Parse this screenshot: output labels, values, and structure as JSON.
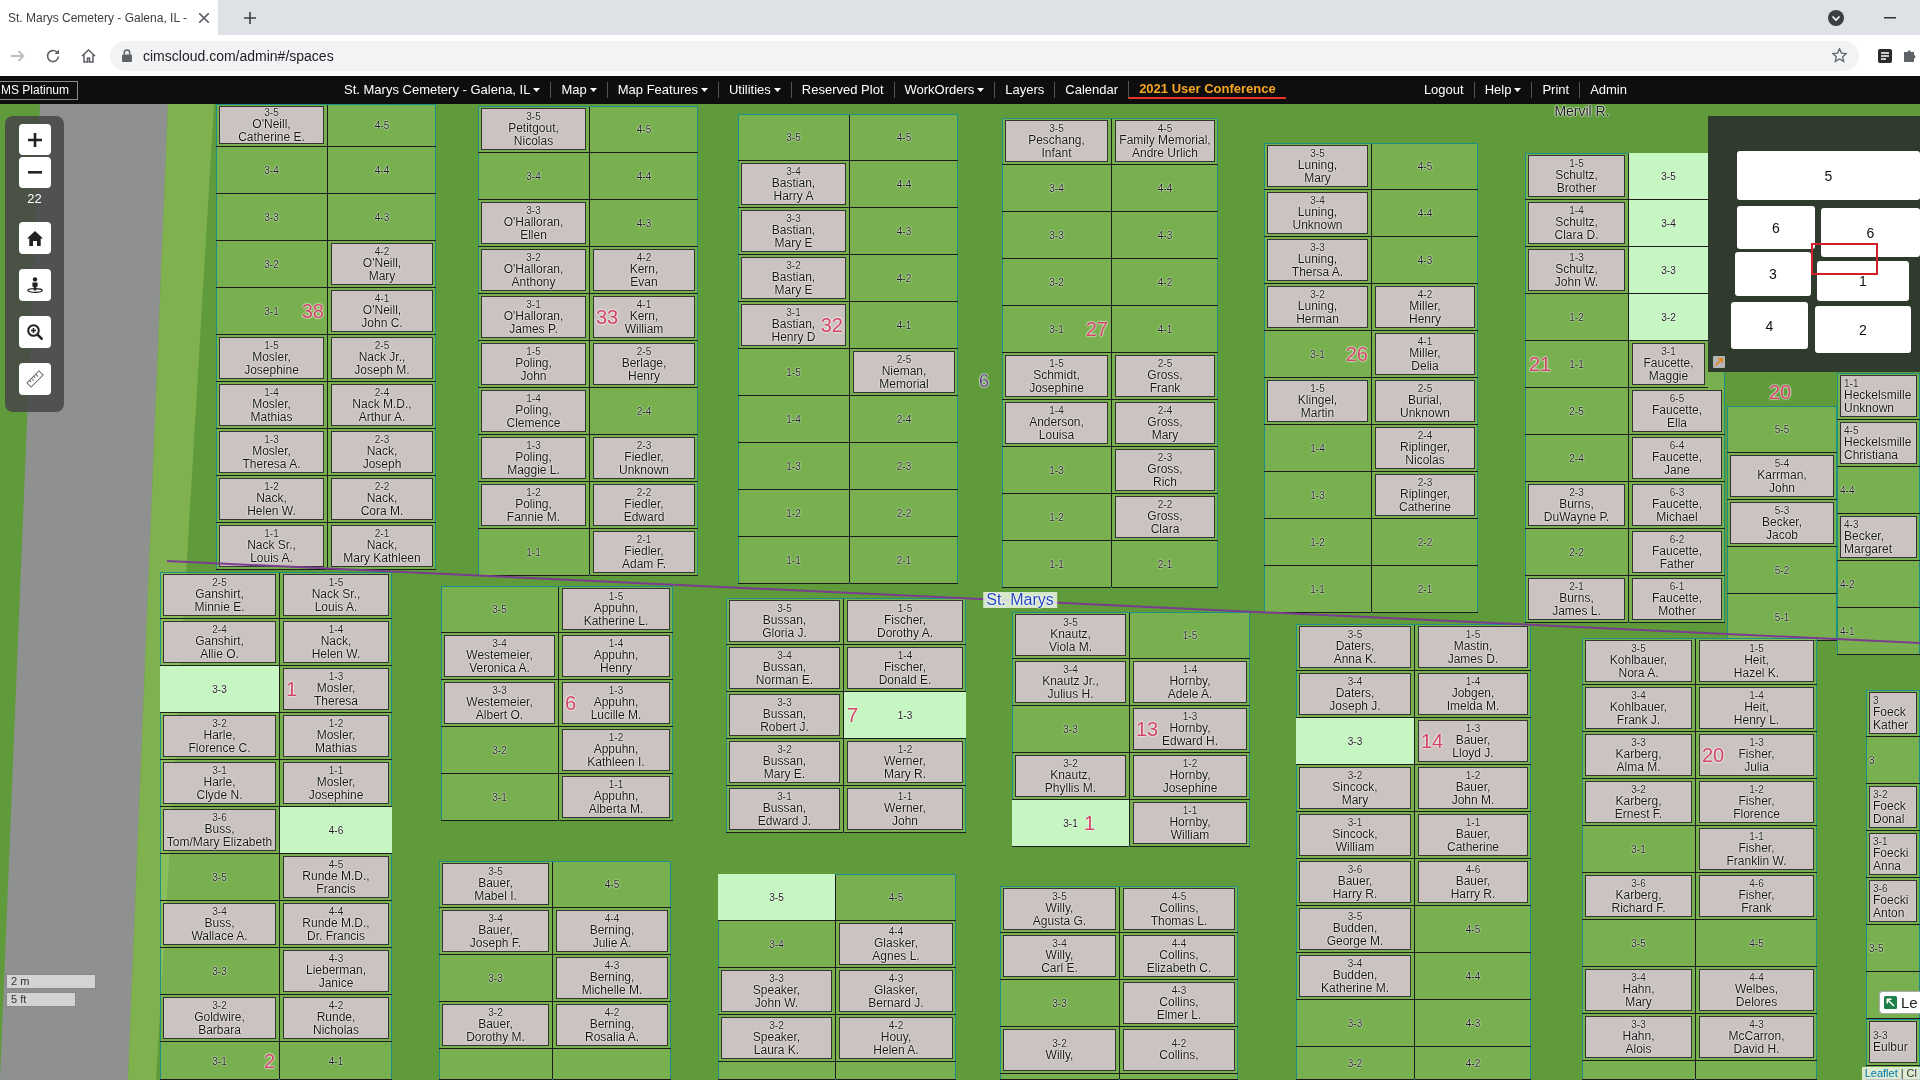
{
  "browser": {
    "tab_title": "St. Marys Cemetery - Galena, IL -",
    "url": "cimscloud.com/admin#/spaces"
  },
  "navbar": {
    "brand": "MS Platinum",
    "items": [
      {
        "label": "St. Marys Cemetery - Galena, IL",
        "menu": true,
        "highlighted": false
      },
      {
        "label": "Map",
        "menu": true,
        "highlighted": false
      },
      {
        "label": "Map Features",
        "menu": true,
        "highlighted": false
      },
      {
        "label": "Utilities",
        "menu": true,
        "highlighted": false
      },
      {
        "label": "Reserved Plot",
        "menu": false,
        "highlighted": false
      },
      {
        "label": "WorkOrders",
        "menu": true,
        "highlighted": false
      },
      {
        "label": "Layers",
        "menu": false,
        "highlighted": false
      },
      {
        "label": "Calendar",
        "menu": false,
        "highlighted": false
      },
      {
        "label": "2021 User Conference",
        "menu": false,
        "highlighted": true
      }
    ],
    "right_items": [
      {
        "label": "Logout",
        "menu": false,
        "highlighted": false
      },
      {
        "label": "Help",
        "menu": true,
        "highlighted": false
      },
      {
        "label": "Print",
        "menu": false,
        "highlighted": false
      },
      {
        "label": "Admin",
        "menu": false,
        "highlighted": false
      }
    ]
  },
  "map": {
    "zoom_level": "22",
    "blocks": [
      {
        "columns": [
          [
            {
              "plot": "3-5",
              "name": "O'Neill,\nCatherine E.",
              "available": false
            },
            {
              "plot": "3-4",
              "available": false
            },
            {
              "plot": "3-3",
              "available": false
            },
            {
              "plot": "3-2",
              "available": false
            },
            {
              "plot": "3-1",
              "available": false
            },
            {
              "plot": "1-5",
              "name": "Mosler,\nJosephine",
              "available": false
            },
            {
              "plot": "1-4",
              "name": "Mosler,\nMathias",
              "available": false
            },
            {
              "plot": "1-3",
              "name": "Mosler,\nTheresa A.",
              "available": false
            },
            {
              "plot": "1-2",
              "name": "Nack,\nHelen W.",
              "available": false
            },
            {
              "plot": "1-1",
              "name": "Nack Sr.,\nLouis A.",
              "available": false
            }
          ],
          [
            {
              "plot": "4-5",
              "available": false
            },
            {
              "plot": "4-4",
              "available": false
            },
            {
              "plot": "4-3",
              "available": false
            },
            {
              "plot": "4-2",
              "name": "O'Neill,\nMary",
              "available": false
            },
            {
              "plot": "4-1",
              "name": "O'Neill,\nJohn C.",
              "available": false
            },
            {
              "plot": "2-5",
              "name": "Nack Jr.,\nJoseph M.",
              "available": false
            },
            {
              "plot": "2-4",
              "name": "Nack M.D.,\nArthur A.",
              "available": false
            },
            {
              "plot": "2-3",
              "name": "Nack,\nJoseph",
              "available": false
            },
            {
              "plot": "2-2",
              "name": "Nack,\nCora M.",
              "available": false
            },
            {
              "plot": "2-1",
              "name": "Nack,\nMary Kathleen",
              "available": false
            }
          ]
        ]
      },
      {
        "columns": [
          [
            {
              "plot": "3-5",
              "name": "Petitgout,\nNicolas",
              "available": false
            },
            {
              "plot": "3-4",
              "available": false
            },
            {
              "plot": "3-3",
              "name": "O'Halloran,\nEllen",
              "available": false
            },
            {
              "plot": "3-2",
              "name": "O'Halloran,\nAnthony",
              "available": false
            },
            {
              "plot": "3-1",
              "name": "O'Halloran,\nJames P.",
              "available": false
            },
            {
              "plot": "1-5",
              "name": "Poling,\nJohn",
              "available": false
            },
            {
              "plot": "1-4",
              "name": "Poling,\nClemence",
              "available": false
            },
            {
              "plot": "1-3",
              "name": "Poling,\nMaggie L.",
              "available": false
            },
            {
              "plot": "1-2",
              "name": "Poling,\nFannie M.",
              "available": false
            },
            {
              "plot": "1-1",
              "available": false
            }
          ],
          [
            {
              "plot": "4-5",
              "available": false
            },
            {
              "plot": "4-4",
              "available": false
            },
            {
              "plot": "4-3",
              "available": false
            },
            {
              "plot": "4-2",
              "name": "Kern,\nEvan",
              "available": false
            },
            {
              "plot": "4-1",
              "name": "Kern,\nWilliam",
              "available": false
            },
            {
              "plot": "2-5",
              "name": "Berlage,\nHenry",
              "available": false
            },
            {
              "plot": "2-4",
              "available": false
            },
            {
              "plot": "2-3",
              "name": "Fiedler,\nUnknown",
              "available": false
            },
            {
              "plot": "2-2",
              "name": "Fiedler,\nEdward",
              "available": false
            },
            {
              "plot": "2-1",
              "name": "Fiedler,\nAdam F.",
              "available": false
            }
          ]
        ]
      },
      {
        "columns": [
          [
            {
              "plot": "3-5",
              "available": false
            },
            {
              "plot": "3-4",
              "name": "Bastian,\nHarry A",
              "available": false
            },
            {
              "plot": "3-3",
              "name": "Bastian,\nMary E",
              "available": false
            },
            {
              "plot": "3-2",
              "name": "Bastian,\nMary E",
              "available": false
            },
            {
              "plot": "3-1",
              "name": "Bastian,\nHenry D",
              "available": false
            },
            {
              "plot": "1-5",
              "available": false
            },
            {
              "plot": "1-4",
              "available": false
            },
            {
              "plot": "1-3",
              "available": false
            },
            {
              "plot": "1-2",
              "available": false
            },
            {
              "plot": "1-1",
              "available": false
            }
          ],
          [
            {
              "plot": "4-5",
              "available": false
            },
            {
              "plot": "4-4",
              "available": false
            },
            {
              "plot": "4-3",
              "available": false
            },
            {
              "plot": "4-2",
              "available": false
            },
            {
              "plot": "4-1",
              "available": false
            },
            {
              "plot": "2-5",
              "name": "Nieman,\nMemorial",
              "available": false
            },
            {
              "plot": "2-4",
              "available": false
            },
            {
              "plot": "2-3",
              "available": false
            },
            {
              "plot": "2-2",
              "available": false
            },
            {
              "plot": "2-1",
              "available": false
            }
          ]
        ]
      },
      {
        "columns": [
          [
            {
              "plot": "3-5",
              "name": "Peschang,\nInfant",
              "available": false
            },
            {
              "plot": "3-4",
              "available": false
            },
            {
              "plot": "3-3",
              "available": false
            },
            {
              "plot": "3-2",
              "available": false
            },
            {
              "plot": "3-1",
              "available": false
            },
            {
              "plot": "1-5",
              "name": "Schmidt,\nJosephine",
              "available": false
            },
            {
              "plot": "1-4",
              "name": "Anderson,\nLouisa",
              "available": false
            },
            {
              "plot": "1-3",
              "available": false
            },
            {
              "plot": "1-2",
              "available": false
            },
            {
              "plot": "1-1",
              "available": false
            }
          ],
          [
            {
              "plot": "4-5",
              "name": "Family Memorial,\nAndre Urlich",
              "available": false
            },
            {
              "plot": "4-4",
              "available": false
            },
            {
              "plot": "4-3",
              "available": false
            },
            {
              "plot": "4-2",
              "available": false
            },
            {
              "plot": "4-1",
              "available": false
            },
            {
              "plot": "2-5",
              "name": "Gross,\nFrank",
              "available": false
            },
            {
              "plot": "2-4",
              "name": "Gross,\nMary",
              "available": false
            },
            {
              "plot": "2-3",
              "name": "Gross,\nRich",
              "available": false
            },
            {
              "plot": "2-2",
              "name": "Gross,\nClara",
              "available": false
            },
            {
              "plot": "2-1",
              "available": false
            }
          ]
        ]
      },
      {
        "columns": [
          [
            {
              "plot": "3-5",
              "name": "Luning,\nMary",
              "available": false
            },
            {
              "plot": "3-4",
              "name": "Luning,\nUnknown",
              "available": false
            },
            {
              "plot": "3-3",
              "name": "Luning,\nThersa A.",
              "available": false
            },
            {
              "plot": "3-2",
              "name": "Luning,\nHerman",
              "available": false
            },
            {
              "plot": "3-1",
              "available": false
            },
            {
              "plot": "1-5",
              "name": "Klingel,\nMartin",
              "available": false
            },
            {
              "plot": "1-4",
              "available": false
            },
            {
              "plot": "1-3",
              "available": false
            },
            {
              "plot": "1-2",
              "available": false
            },
            {
              "plot": "1-1",
              "available": false
            }
          ],
          [
            {
              "plot": "4-5",
              "available": false
            },
            {
              "plot": "4-4",
              "available": false
            },
            {
              "plot": "4-3",
              "available": false
            },
            {
              "plot": "4-2",
              "name": "Miller,\nHenry",
              "available": false
            },
            {
              "plot": "4-1",
              "name": "Miller,\nDelia",
              "available": false
            },
            {
              "plot": "2-5",
              "name": "Burial,\nUnknown",
              "available": false
            },
            {
              "plot": "2-4",
              "name": "Riplinger,\nNicolas",
              "available": false
            },
            {
              "plot": "2-3",
              "name": "Riplinger,\nCatherine",
              "available": false
            },
            {
              "plot": "2-2",
              "available": false
            },
            {
              "plot": "2-1",
              "available": false
            }
          ]
        ]
      },
      {
        "columns": [
          [
            {
              "plot": "1-5",
              "name": "Schultz,\nBrother",
              "available": false
            },
            {
              "plot": "1-4",
              "name": "Schultz,\nClara D.",
              "available": false
            },
            {
              "plot": "1-3",
              "name": "Schultz,\nJohn W.",
              "available": false
            },
            {
              "plot": "1-2",
              "available": false
            },
            {
              "plot": "1-1",
              "available": false
            },
            {
              "plot": "2-5",
              "available": false
            },
            {
              "plot": "2-4",
              "available": false
            },
            {
              "plot": "2-3",
              "name": "Burns,\nDuWayne P.",
              "available": false
            },
            {
              "plot": "2-2",
              "available": false
            },
            {
              "plot": "2-1",
              "name": "Burns,\nJames L.",
              "available": false
            }
          ],
          [
            {
              "plot": "3-5",
              "available": true
            },
            {
              "plot": "3-4",
              "available": true
            },
            {
              "plot": "3-3",
              "available": true
            },
            {
              "plot": "3-2",
              "available": true
            },
            {
              "plot": "3-1",
              "name": "Faucette,\nMaggie",
              "available": false
            },
            {
              "plot": "6-5",
              "name": "Faucette,\nElla",
              "available": false
            },
            {
              "plot": "6-4",
              "name": "Faucette,\nJane",
              "available": false
            },
            {
              "plot": "6-3",
              "name": "Faucette,\nMichael",
              "available": false
            },
            {
              "plot": "6-2",
              "name": "Faucette,\nFather",
              "available": false
            },
            {
              "plot": "6-1",
              "name": "Faucette,\nMother",
              "available": false
            }
          ]
        ]
      },
      {
        "columns": [
          [
            {
              "plot": "5-5",
              "available": false
            },
            {
              "plot": "5-4",
              "name": "Karrman,\nJohn",
              "available": false
            },
            {
              "plot": "5-3",
              "name": "Becker,\nJacob",
              "available": false
            },
            {
              "plot": "5-2",
              "available": false
            },
            {
              "plot": "5-1",
              "available": false
            }
          ]
        ]
      },
      {
        "columns": [
          [
            {
              "plot": "1-1",
              "name": "Heckelsmille\nUnknown",
              "available": false
            },
            {
              "plot": "4-5",
              "name": "Heckelsmille\nChristiana",
              "available": false
            },
            {
              "plot": "4-4",
              "available": false
            },
            {
              "plot": "4-3",
              "name": "Becker,\nMargaret",
              "available": false
            },
            {
              "plot": "4-2",
              "available": false
            },
            {
              "plot": "4-1",
              "available": false
            }
          ]
        ]
      },
      {
        "columns": [
          [
            {
              "plot": "2-5",
              "name": "Ganshirt,\nMinnie E.",
              "available": false
            },
            {
              "plot": "2-4",
              "name": "Ganshirt,\nAllie O.",
              "available": false
            },
            {
              "plot": "3-3",
              "available": true
            },
            {
              "plot": "3-2",
              "name": "Harle,\nFlorence C.",
              "available": false
            },
            {
              "plot": "3-1",
              "name": "Harle,\nClyde N.",
              "available": false
            },
            {
              "plot": "3-6",
              "name": "Buss,\nTom/Mary Elizabeth",
              "available": false
            },
            {
              "plot": "3-5",
              "available": false
            },
            {
              "plot": "3-4",
              "name": "Buss,\nWallace A.",
              "available": false
            },
            {
              "plot": "3-3",
              "available": false
            },
            {
              "plot": "3-2",
              "name": "Goldwire,\nBarbara",
              "available": false
            },
            {
              "plot": "3-1",
              "available": false
            }
          ],
          [
            {
              "plot": "1-5",
              "name": "Nack Sr.,\nLouis A.",
              "available": false
            },
            {
              "plot": "1-4",
              "name": "Nack,\nHelen W.",
              "available": false
            },
            {
              "plot": "1-3",
              "name": "Mosler,\nTheresa",
              "available": false
            },
            {
              "plot": "1-2",
              "name": "Mosler,\nMathias",
              "available": false
            },
            {
              "plot": "1-1",
              "name": "Mosler,\nJosephine",
              "available": false
            },
            {
              "plot": "4-6",
              "available": true
            },
            {
              "plot": "4-5",
              "name": "Runde M.D.,\nFrancis",
              "available": false
            },
            {
              "plot": "4-4",
              "name": "Runde M.D.,\nDr. Francis",
              "available": false
            },
            {
              "plot": "4-3",
              "name": "Lieberman,\nJanice",
              "available": false
            },
            {
              "plot": "4-2",
              "name": "Runde,\nNicholas",
              "available": false
            },
            {
              "plot": "4-1",
              "available": false
            }
          ]
        ]
      },
      {
        "columns": [
          [
            {
              "plot": "3-5",
              "available": false
            },
            {
              "plot": "3-4",
              "name": "Westemeier,\nVeronica A.",
              "available": false
            },
            {
              "plot": "3-3",
              "name": "Westemeier,\nAlbert O.",
              "available": false
            },
            {
              "plot": "3-2",
              "available": false
            },
            {
              "plot": "3-1",
              "available": false
            }
          ],
          [
            {
              "plot": "1-5",
              "name": "Appuhn,\nKatherine L.",
              "available": false
            },
            {
              "plot": "1-4",
              "name": "Appuhn,\nHenry",
              "available": false
            },
            {
              "plot": "1-3",
              "name": "Appuhn,\nLucille M.",
              "available": false
            },
            {
              "plot": "1-2",
              "name": "Appuhn,\nKathleen I.",
              "available": false
            },
            {
              "plot": "1-1",
              "name": "Appuhn,\nAlberta M.",
              "available": false
            }
          ]
        ]
      },
      {
        "columns": [
          [
            {
              "plot": "3-5",
              "name": "Bussan,\nGloria J.",
              "available": false
            },
            {
              "plot": "3-4",
              "name": "Bussan,\nNorman E.",
              "available": false
            },
            {
              "plot": "3-3",
              "name": "Bussan,\nRobert J.",
              "available": false
            },
            {
              "plot": "3-2",
              "name": "Bussan,\nMary E.",
              "available": false
            },
            {
              "plot": "3-1",
              "name": "Bussan,\nEdward J.",
              "available": false
            }
          ],
          [
            {
              "plot": "1-5",
              "name": "Fischer,\nDorothy A.",
              "available": false
            },
            {
              "plot": "1-4",
              "name": "Fischer,\nDonald E.",
              "available": false
            },
            {
              "plot": "1-3",
              "available": true
            },
            {
              "plot": "1-2",
              "name": "Werner,\nMary R.",
              "available": false
            },
            {
              "plot": "1-1",
              "name": "Werner,\nJohn",
              "available": false
            }
          ]
        ]
      },
      {
        "columns": [
          [
            {
              "plot": "3-5",
              "name": "Knautz,\nViola M.",
              "available": false
            },
            {
              "plot": "3-4",
              "name": "Knautz Jr.,\nJulius H.",
              "available": false
            },
            {
              "plot": "3-3",
              "available": false
            },
            {
              "plot": "3-2",
              "name": "Knautz,\nPhyllis M.",
              "available": false
            },
            {
              "plot": "3-1",
              "available": true
            }
          ],
          [
            {
              "plot": "1-5",
              "available": false
            },
            {
              "plot": "1-4",
              "name": "Hornby,\nAdele A.",
              "available": false
            },
            {
              "plot": "1-3",
              "name": "Hornby,\nEdward H.",
              "available": false
            },
            {
              "plot": "1-2",
              "name": "Hornby,\nJosephine",
              "available": false
            },
            {
              "plot": "1-1",
              "name": "Hornby,\nWilliam",
              "available": false
            }
          ]
        ]
      },
      {
        "columns": [
          [
            {
              "plot": "3-5",
              "name": "Daters,\nAnna K.",
              "available": false
            },
            {
              "plot": "3-4",
              "name": "Daters,\nJoseph J.",
              "available": false
            },
            {
              "plot": "3-3",
              "available": true
            },
            {
              "plot": "3-2",
              "name": "Sincock,\nMary",
              "available": false
            },
            {
              "plot": "3-1",
              "name": "Sincock,\nWilliam",
              "available": false
            },
            {
              "plot": "3-6",
              "name": "Bauer,\nHarry R.",
              "available": false
            },
            {
              "plot": "3-5",
              "name": "Budden,\nGeorge M.",
              "available": false
            },
            {
              "plot": "3-4",
              "name": "Budden,\nKatherine M.",
              "available": false
            },
            {
              "plot": "3-3",
              "available": false
            },
            {
              "plot": "3-2",
              "available": false
            }
          ],
          [
            {
              "plot": "1-5",
              "name": "Mastin,\nJames D.",
              "available": false
            },
            {
              "plot": "1-4",
              "name": "Jobgen,\nImelda M.",
              "available": false
            },
            {
              "plot": "1-3",
              "name": "Bauer,\nLloyd J.",
              "available": false
            },
            {
              "plot": "1-2",
              "name": "Bauer,\nJohn M.",
              "available": false
            },
            {
              "plot": "1-1",
              "name": "Bauer,\nCatherine",
              "available": false
            },
            {
              "plot": "4-6",
              "name": "Bauer,\nHarry R.",
              "available": false
            },
            {
              "plot": "4-5",
              "available": false
            },
            {
              "plot": "4-4",
              "available": false
            },
            {
              "plot": "4-3",
              "available": false
            },
            {
              "plot": "4-2",
              "available": false
            }
          ]
        ]
      },
      {
        "columns": [
          [
            {
              "plot": "3-5",
              "name": "Kohlbauer,\nNora A.",
              "available": false
            },
            {
              "plot": "3-4",
              "name": "Kohlbauer,\nFrank J.",
              "available": false
            },
            {
              "plot": "3-3",
              "name": "Karberg,\nAlma M.",
              "available": false
            },
            {
              "plot": "3-2",
              "name": "Karberg,\nErnest F.",
              "available": false
            },
            {
              "plot": "3-1",
              "available": false
            },
            {
              "plot": "3-6",
              "name": "Karberg,\nRichard F.",
              "available": false
            },
            {
              "plot": "3-5",
              "available": false
            },
            {
              "plot": "3-4",
              "name": "Hahn,\nMary",
              "available": false
            },
            {
              "plot": "3-3",
              "name": "Hahn,\nAlois",
              "available": false
            }
          ],
          [
            {
              "plot": "1-5",
              "name": "Heit,\nHazel K.",
              "available": false
            },
            {
              "plot": "1-4",
              "name": "Heit,\nHenry L.",
              "available": false
            },
            {
              "plot": "1-3",
              "name": "Fisher,\nJulia",
              "available": false
            },
            {
              "plot": "1-2",
              "name": "Fisher,\nFlorence",
              "available": false
            },
            {
              "plot": "1-1",
              "name": "Fisher,\nFranklin W.",
              "available": false
            },
            {
              "plot": "4-6",
              "name": "Fisher,\nFrank",
              "available": false
            },
            {
              "plot": "4-5",
              "available": false
            },
            {
              "plot": "4-4",
              "name": "Welbes,\nDelores",
              "available": false
            },
            {
              "plot": "4-3",
              "name": "McCarron,\nDavid H.",
              "available": false
            }
          ]
        ]
      },
      {
        "columns": [
          [
            {
              "plot": "3",
              "name": "Foeck\nKather",
              "available": false
            },
            {
              "plot": "3",
              "available": false
            },
            {
              "plot": "3-2",
              "name": "Foeck\nDonal",
              "available": false
            },
            {
              "plot": "3-1",
              "name": "Foecki\nAnna",
              "available": false
            },
            {
              "plot": "3-6",
              "name": "Foecki\nAnton",
              "available": false
            },
            {
              "plot": "3-5",
              "available": false
            }
          ]
        ]
      },
      {
        "columns": [
          [
            {
              "plot": "3-5",
              "name": "Bauer,\nMabel I.",
              "available": false
            },
            {
              "plot": "3-4",
              "name": "Bauer,\nJoseph F.",
              "available": false
            },
            {
              "plot": "3-3",
              "available": false
            },
            {
              "plot": "3-2",
              "name": "Bauer,\nDorothy M.",
              "available": false
            }
          ],
          [
            {
              "plot": "4-5",
              "available": false
            },
            {
              "plot": "4-4",
              "name": "Berning,\nJulie A.",
              "available": false
            },
            {
              "plot": "4-3",
              "name": "Berning,\nMichelle M.",
              "available": false
            },
            {
              "plot": "4-2",
              "name": "Berning,\nRosalia A.",
              "available": false
            }
          ]
        ]
      },
      {
        "columns": [
          [
            {
              "plot": "3-5",
              "available": true
            },
            {
              "plot": "3-4",
              "available": false
            },
            {
              "plot": "3-3",
              "name": "Speaker,\nJohn W.",
              "available": false
            },
            {
              "plot": "3-2",
              "name": "Speaker,\nLaura K.",
              "available": false
            }
          ],
          [
            {
              "plot": "4-5",
              "available": false
            },
            {
              "plot": "4-4",
              "name": "Glasker,\nAgnes L.",
              "available": false
            },
            {
              "plot": "4-3",
              "name": "Glasker,\nBernard J.",
              "available": false
            },
            {
              "plot": "4-2",
              "name": "Houy,\nHelen A.",
              "available": false
            }
          ]
        ]
      },
      {
        "columns": [
          [
            {
              "plot": "3-5",
              "name": "Willy,\nAgusta G.",
              "available": false
            },
            {
              "plot": "3-4",
              "name": "Willy,\nCarl E.",
              "available": false
            },
            {
              "plot": "3-3",
              "available": false
            },
            {
              "plot": "3-2",
              "name": "Willy,",
              "available": false
            }
          ],
          [
            {
              "plot": "4-5",
              "name": "Collins,\nThomas L.",
              "available": false
            },
            {
              "plot": "4-4",
              "name": "Collins,\nElizabeth C.",
              "available": false
            },
            {
              "plot": "4-3",
              "name": "Collins,\nElmer L.",
              "available": false
            },
            {
              "plot": "4-2",
              "name": "Collins,",
              "available": false
            }
          ]
        ]
      },
      {
        "columns": [
          [
            {
              "plot": "3-3",
              "name": "Eulbur",
              "available": false
            }
          ]
        ]
      }
    ],
    "lot_numbers": [
      "38",
      "33",
      "32",
      "27",
      "26",
      "21",
      "20",
      "1",
      "6",
      "7",
      "13",
      "1",
      "14",
      "20",
      "2"
    ],
    "labels": [
      {
        "kind": "name",
        "text": "Mervil R."
      },
      {
        "kind": "section",
        "text": "6"
      },
      {
        "kind": "road",
        "text": "St. Marys"
      }
    ],
    "minimap": {
      "sections": [
        "5",
        "6",
        "6",
        "3",
        "1",
        "4",
        "2"
      ]
    },
    "scale": [
      "2 m",
      "5 ft"
    ],
    "legend_button": "Le",
    "attribution": {
      "link": "Leaflet",
      "text": "| Cl"
    }
  }
}
